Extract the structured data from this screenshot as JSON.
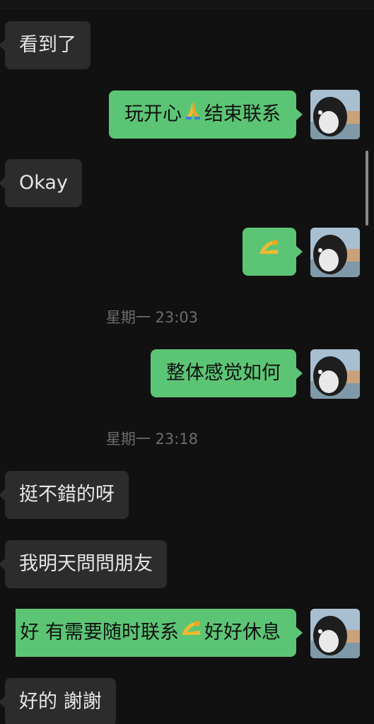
{
  "messages": [
    {
      "side": "in",
      "text": "看到了"
    },
    {
      "side": "out",
      "text_before": "玩开心",
      "emoji": "folded-hands",
      "text_after": "结束联系"
    },
    {
      "side": "in",
      "text": "Okay"
    },
    {
      "side": "out",
      "emoji": "pinching-hand"
    },
    {
      "type": "time",
      "text": "星期一 23:03"
    },
    {
      "side": "out",
      "text": "整体感觉如何"
    },
    {
      "type": "time",
      "text": "星期一 23:18"
    },
    {
      "side": "in",
      "text": "挺不錯的呀"
    },
    {
      "side": "in",
      "text": "我明天問問朋友"
    },
    {
      "side": "out",
      "text_before": "好 有需要随时联系",
      "emoji": "pinching-hand",
      "text_after": "好好休息"
    },
    {
      "side": "in",
      "text": "好的 謝謝"
    }
  ],
  "colors": {
    "background": "#111111",
    "incoming_bubble": "#2c2c2c",
    "outgoing_bubble": "#5cc575",
    "timestamp": "#6c6c6c"
  },
  "avatar": {
    "icon": "penguin-avatar"
  }
}
